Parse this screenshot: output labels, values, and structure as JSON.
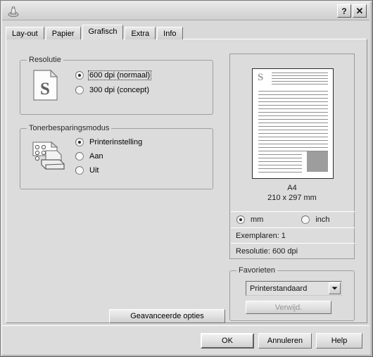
{
  "window": {
    "icon": "printer-icon",
    "help_button": "?",
    "close_button": "✕"
  },
  "tabs": [
    {
      "label": "Lay-out",
      "selected": false
    },
    {
      "label": "Papier",
      "selected": false
    },
    {
      "label": "Grafisch",
      "selected": true
    },
    {
      "label": "Extra",
      "selected": false
    },
    {
      "label": "Info",
      "selected": false
    }
  ],
  "resolution_group": {
    "title": "Resolutie",
    "icon": "document-s-icon",
    "options": [
      {
        "label": "600 dpi (normaal)",
        "checked": true,
        "focused": true
      },
      {
        "label": "300 dpi (concept)",
        "checked": false,
        "focused": false
      }
    ]
  },
  "toner_group": {
    "title": "Tonerbesparingsmodus",
    "icon": "printer-toner-icon",
    "options": [
      {
        "label": "Printerinstelling",
        "checked": true
      },
      {
        "label": "Aan",
        "checked": false
      },
      {
        "label": "Uit",
        "checked": false
      }
    ]
  },
  "advanced_button": {
    "label": "Geavanceerde opties"
  },
  "preview": {
    "page_letter": "S",
    "paper_name": "A4",
    "paper_dims": "210 x 297 mm",
    "units": [
      {
        "label": "mm",
        "checked": true
      },
      {
        "label": "inch",
        "checked": false
      }
    ],
    "copies_row": "Exemplaren: 1",
    "resolution_row": "Resolutie: 600 dpi"
  },
  "favorites_group": {
    "title": "Favorieten",
    "selected_value": "Printerstandaard",
    "dropdown_arrow": "▼",
    "delete_button": {
      "label": "Verwijd.",
      "disabled": true
    }
  },
  "footer_buttons": [
    {
      "label": "OK",
      "default": true
    },
    {
      "label": "Annuleren",
      "default": false
    },
    {
      "label": "Help",
      "default": false
    }
  ],
  "colors": {
    "window_bg": "#d9d9d9",
    "panel_bg": "#dcdcdc",
    "group_border": "#9f9f9f",
    "text": "#000000",
    "sheet_box": "#9d9d9d",
    "disabled_text": "#959595"
  }
}
